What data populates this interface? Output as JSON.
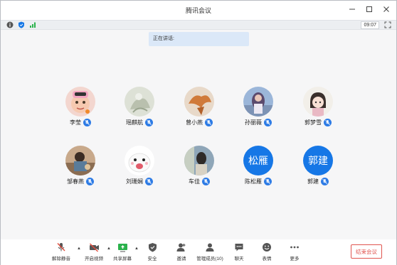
{
  "window": {
    "title": "腾讯会议"
  },
  "infobar": {
    "timer": "09:07"
  },
  "speaking": {
    "label": "正在讲话:"
  },
  "participants": [
    {
      "name": "李莹"
    },
    {
      "name": "瑶麒航"
    },
    {
      "name": "曾小燕"
    },
    {
      "name": "孙丽薇"
    },
    {
      "name": "郭梦雪"
    },
    {
      "name": "邹春燕"
    },
    {
      "name": "刘珊娴"
    },
    {
      "name": "车佳"
    },
    {
      "name": "陈松雁",
      "avatar_text": "松雁"
    },
    {
      "name": "郭建",
      "avatar_text": "郭建"
    }
  ],
  "toolbar": {
    "unmute": "解除静音",
    "start_video": "开启视频",
    "share_screen": "共享屏幕",
    "security": "安全",
    "invite": "邀请",
    "manage_members": "管理成员(10)",
    "chat": "聊天",
    "reactions": "表情",
    "more": "更多",
    "end_meeting": "结束会议"
  },
  "colors": {
    "accent": "#1677e6",
    "end_button": "#e0554f",
    "mic_off": "#e04c3c"
  }
}
